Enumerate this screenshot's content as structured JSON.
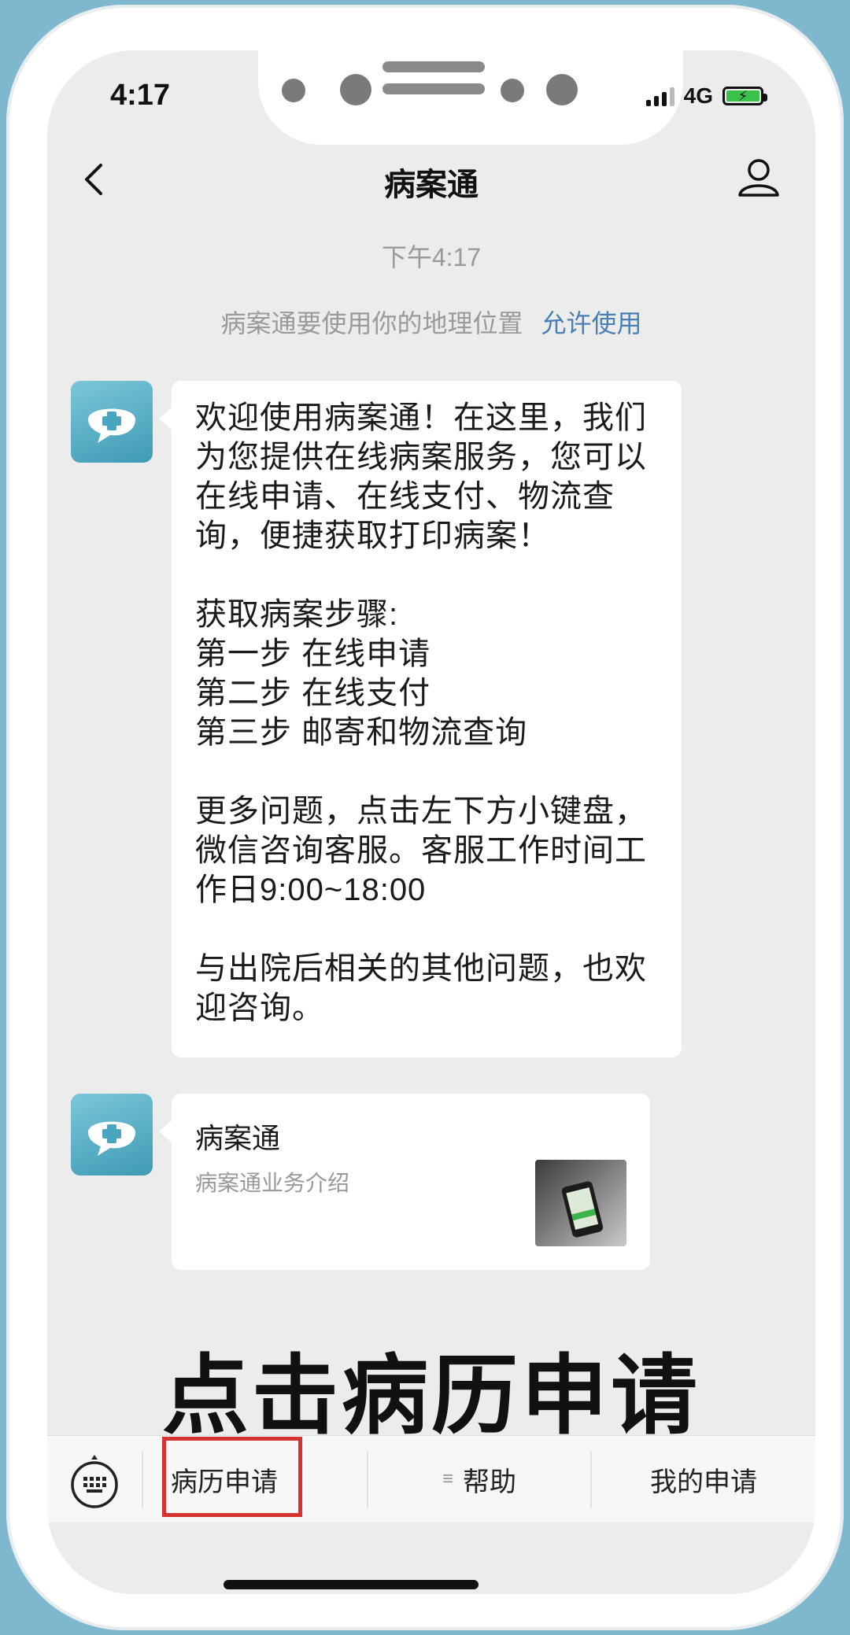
{
  "status_bar": {
    "time": "4:17",
    "network": "4G"
  },
  "header": {
    "title": "病案通"
  },
  "chat": {
    "timestamp": "下午4:17",
    "location_notice": "病案通要使用你的地理位置",
    "location_action": "允许使用",
    "welcome_message": "欢迎使用病案通！在这里，我们为您提供在线病案服务，您可以在线申请、在线支付、物流查询，便捷获取打印病案！\n\n获取病案步骤:\n第一步 在线申请\n第二步 在线支付\n第三步 邮寄和物流查询\n\n更多问题，点击左下方小键盘，微信咨询客服。客服工作时间工作日9:00~18:00\n\n与出院后相关的其他问题，也欢迎咨询。",
    "card": {
      "title": "病案通",
      "subtitle": "病案通业务介绍"
    }
  },
  "overlay_caption": "点击病历申请",
  "menu": {
    "items": [
      {
        "label": "病历申请"
      },
      {
        "label": "帮助"
      },
      {
        "label": "我的申请"
      }
    ]
  },
  "colors": {
    "highlight": "#d6322f",
    "link": "#4a7fb5",
    "avatar": "#4aa5bf"
  },
  "icons": [
    "back-icon",
    "profile-icon",
    "chat-plus-icon",
    "keyboard-icon",
    "menu-list-icon"
  ]
}
